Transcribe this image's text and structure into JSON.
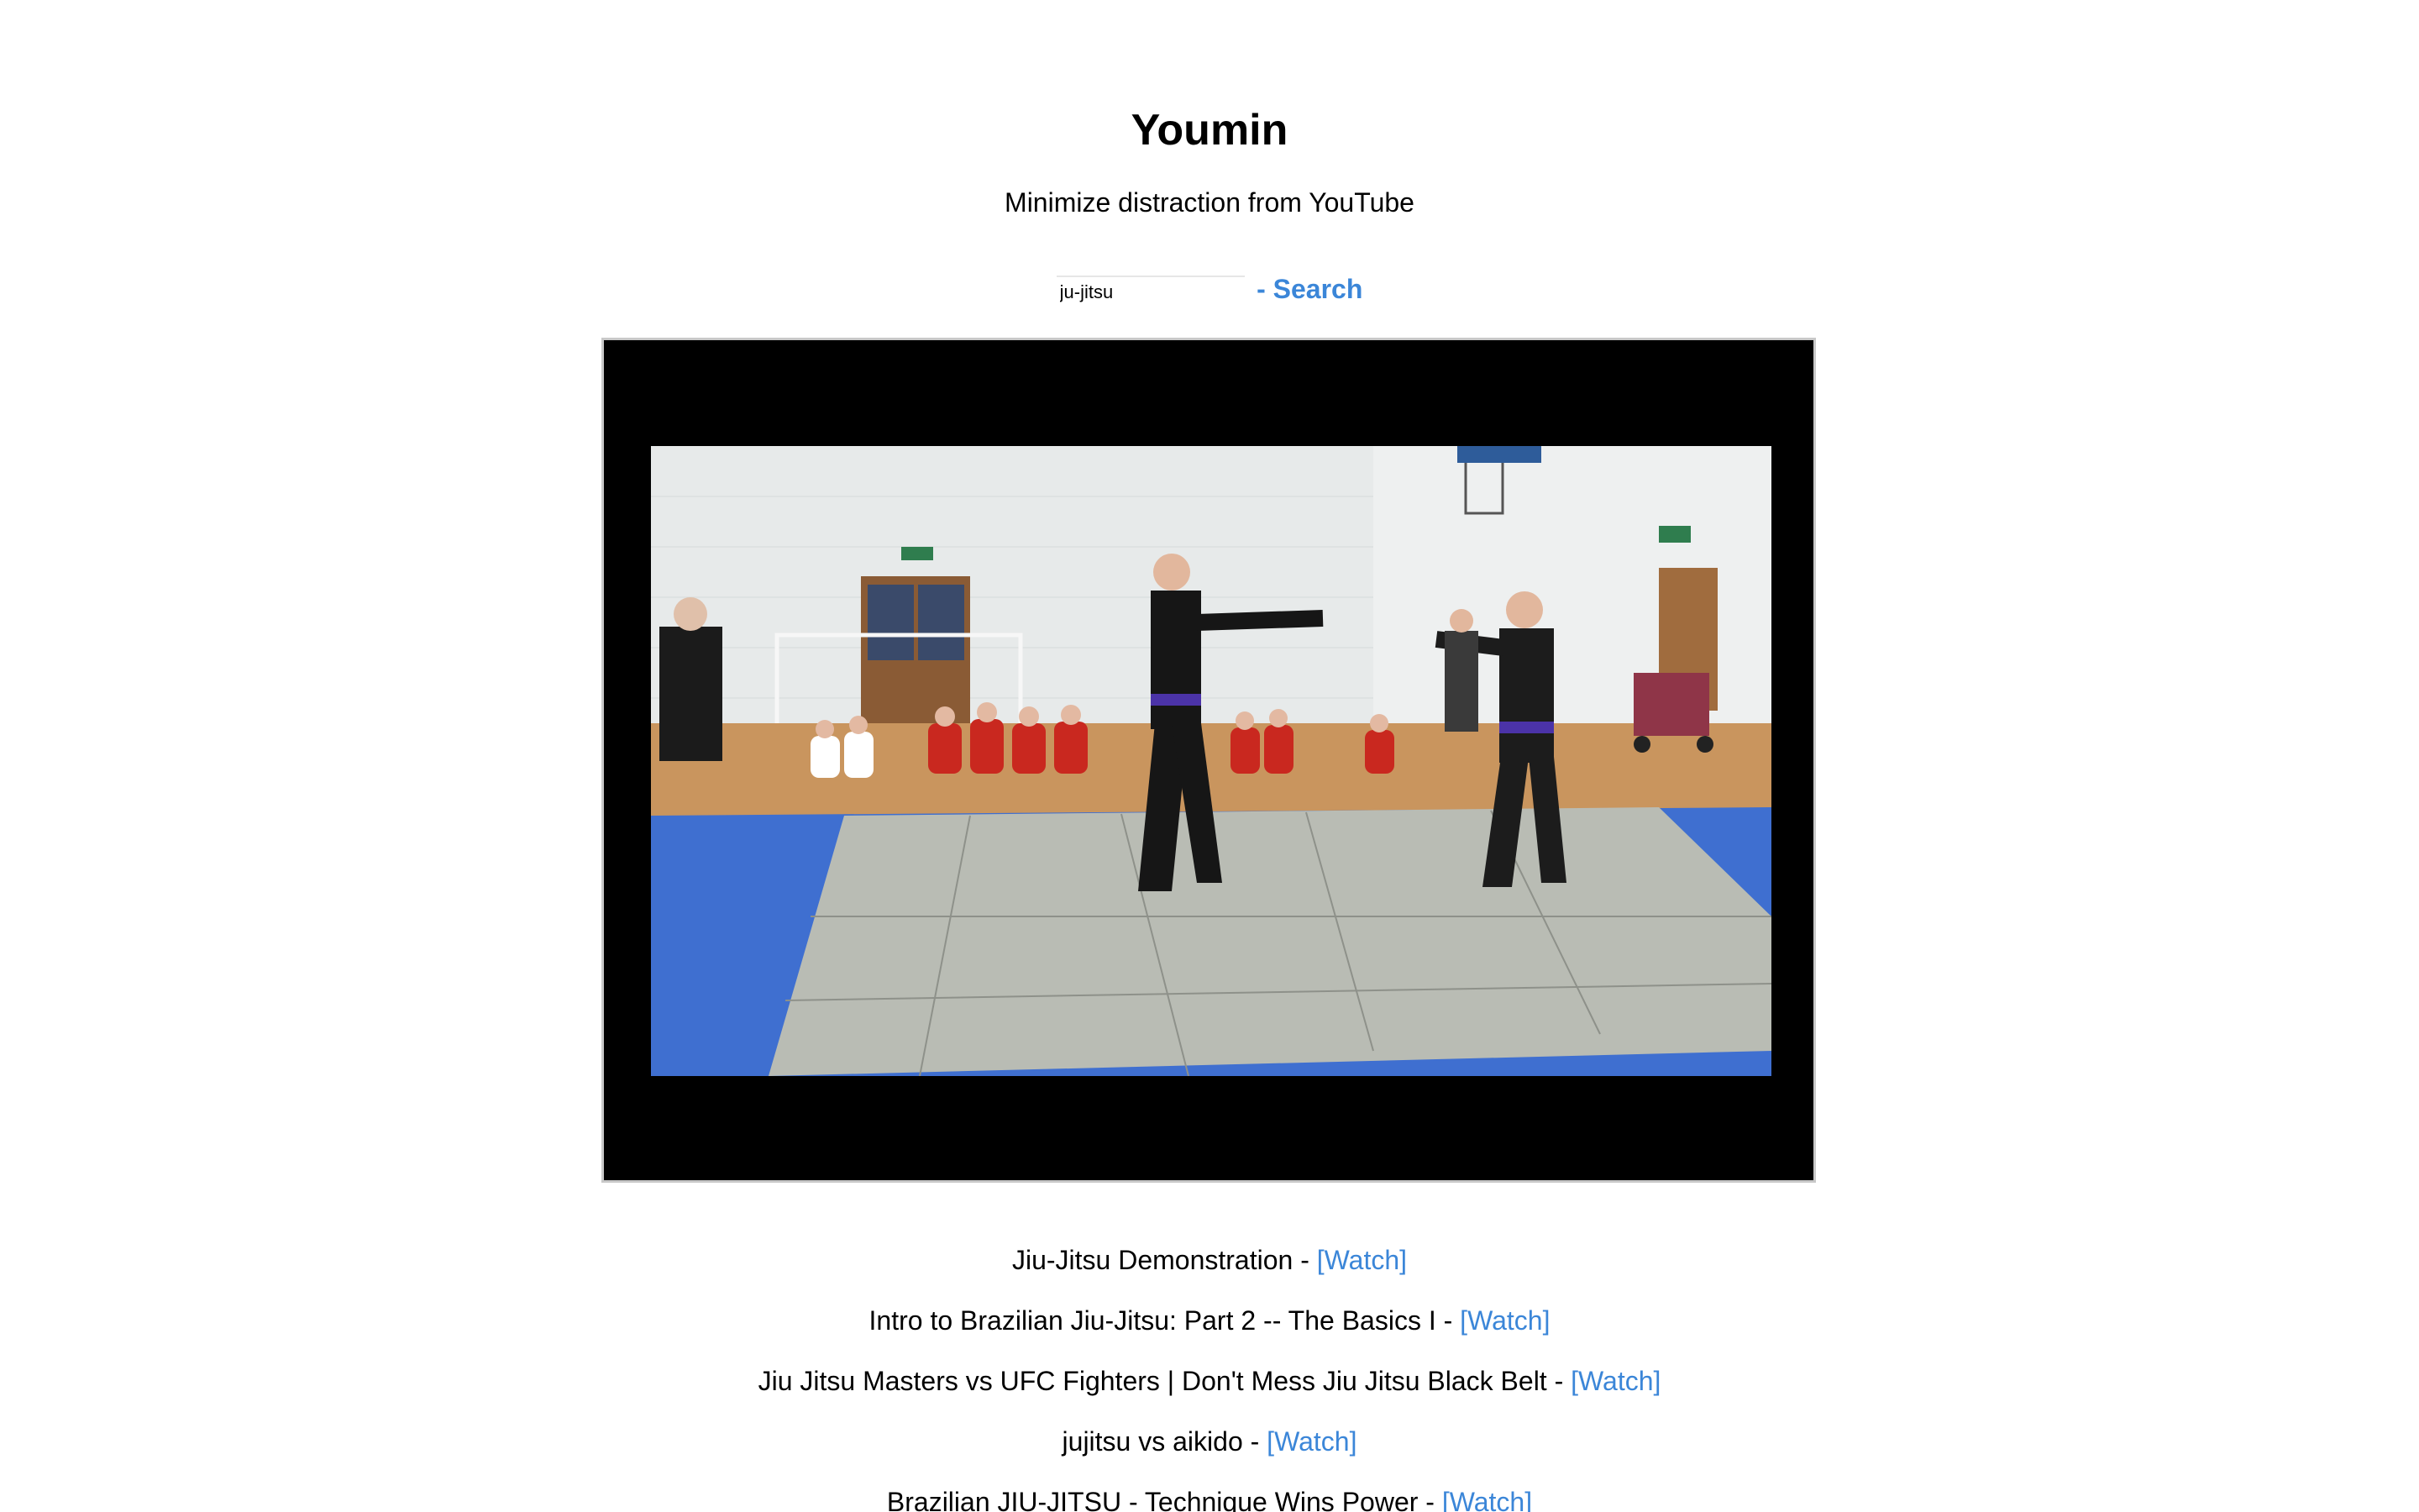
{
  "app": {
    "title": "Youmin",
    "subtitle": "Minimize distraction from YouTube"
  },
  "search": {
    "value": "ju-jitsu",
    "link_label": "- Search"
  },
  "player": {
    "background_color": "#000000"
  },
  "results": [
    {
      "title": "Jiu-Jitsu Demonstration",
      "separator": " - ",
      "watch_label": "[Watch]"
    },
    {
      "title": "Intro to Brazilian Jiu-Jitsu: Part 2 -- The Basics I",
      "separator": " - ",
      "watch_label": "[Watch]"
    },
    {
      "title": "Jiu Jitsu Masters vs UFC Fighters | Don't Mess Jiu Jitsu Black Belt",
      "separator": " - ",
      "watch_label": "[Watch]"
    },
    {
      "title": "jujitsu vs aikido",
      "separator": " - ",
      "watch_label": "[Watch]"
    },
    {
      "title": "Brazilian JIU-JITSU - Technique Wins Power",
      "separator": " - ",
      "watch_label": "[Watch]"
    }
  ],
  "colors": {
    "link": "#3b86d8",
    "text": "#000000",
    "background": "#ffffff"
  }
}
